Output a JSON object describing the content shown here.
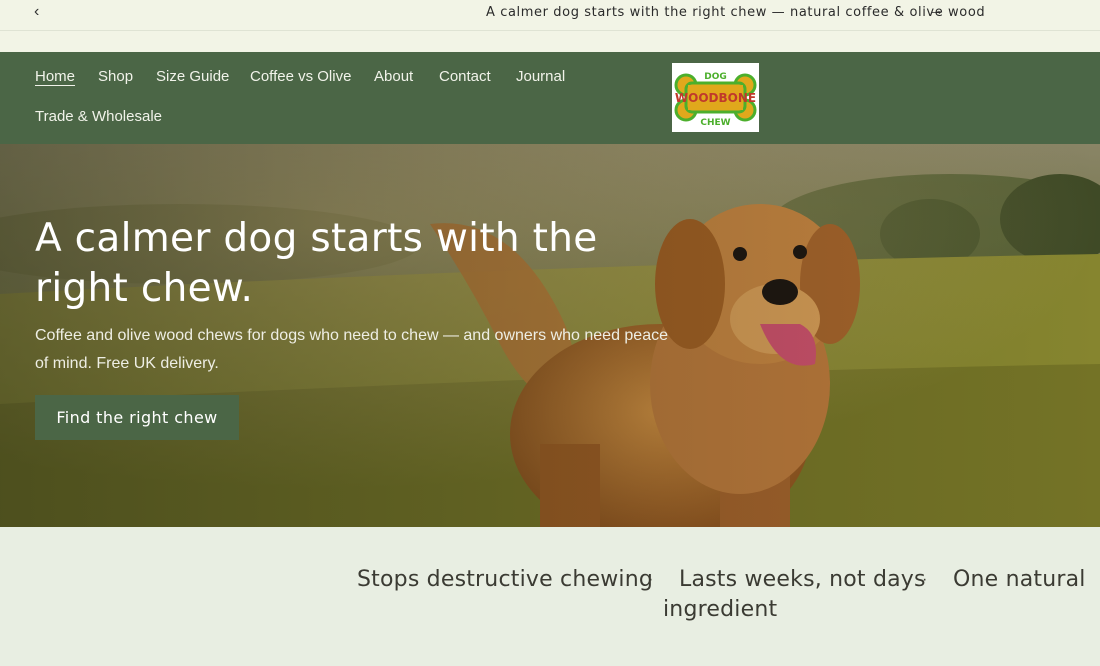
{
  "announcement": {
    "message": "A calmer dog starts with the right chew — natural coffee & olive wood",
    "prev_icon": "‹",
    "next_icon": "→"
  },
  "nav": {
    "items": [
      {
        "label": "Home",
        "active": true
      },
      {
        "label": "Shop"
      },
      {
        "label": "Size Guide"
      },
      {
        "label": "Coffee vs Olive"
      },
      {
        "label": "About"
      },
      {
        "label": "Contact"
      },
      {
        "label": "Journal"
      },
      {
        "label": "Trade & Wholesale"
      }
    ]
  },
  "logo": {
    "top": "DOG",
    "middle": "WOODBONE",
    "bottom": "CHEW"
  },
  "hero": {
    "title": "A calmer dog starts with the right chew.",
    "subtitle": "Coffee and olive wood chews for dogs who need to chew — and owners who need peace of mind. Free UK delivery.",
    "cta_label": "Find the right chew"
  },
  "benefits": {
    "items": [
      "Stops destructive chewing",
      "Lasts weeks, not days",
      "One natural",
      "ingredient"
    ],
    "separator": "·"
  },
  "colors": {
    "brand_green": "#4b6646",
    "announcement_bg": "#f2f4e6",
    "strip_bg": "#e8eee2",
    "logo_orange": "#e0a81c",
    "logo_green": "#4caf2c",
    "logo_red": "#c0392b"
  }
}
